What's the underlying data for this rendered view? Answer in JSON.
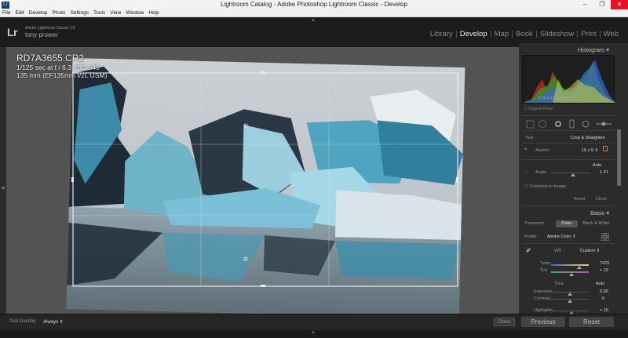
{
  "window": {
    "title": "Lightroom Catalog - Adobe Photoshop Lightroom Classic - Develop",
    "min": "–",
    "max": "❐",
    "close": "✕"
  },
  "menu": [
    "File",
    "Edit",
    "Develop",
    "Photo",
    "Settings",
    "Tools",
    "View",
    "Window",
    "Help"
  ],
  "identity": {
    "logo": "Lr",
    "product": "Adobe Lightroom Classic CC",
    "user": "tony prower"
  },
  "modules": {
    "items": [
      "Library",
      "Develop",
      "Map",
      "Book",
      "Slideshow",
      "Print",
      "Web"
    ],
    "active": "Develop"
  },
  "photo_info": {
    "filename": "RD7A3655.CR2",
    "exposure": "1/125 sec at f / 6.3, ISO 640",
    "lens": "135 mm (EF135mm f/2L USM)"
  },
  "toolbar": {
    "overlay_label": "Tool Overlay :",
    "overlay_value": "Always",
    "done": "Done",
    "previous": "Previous",
    "reset": "Reset"
  },
  "histogram": {
    "header": "Histogram",
    "stats": "R  29.1  G  31.6  B  36.7  %",
    "original_photo": "Original Photo"
  },
  "crop": {
    "tool_label": "Tool :",
    "tool_value": "Crop & Straighten",
    "aspect_label": "Aspect :",
    "aspect_value": "16 x 9",
    "auto": "Auto",
    "angle_label": "Angle",
    "angle_value": "1.41",
    "angle_fraction": 0.55,
    "constrain": "Constrain to Image",
    "reset": "Reset",
    "close": "Close"
  },
  "basic": {
    "header": "Basic",
    "treatment_label": "Treatment :",
    "treatment_color": "Color",
    "treatment_bw": "Black & White",
    "profile_label": "Profile :",
    "profile_value": "Adobe Color",
    "wb_label": "WB :",
    "wb_value": "Custom",
    "temp_label": "Temp",
    "temp_value": "7476",
    "temp_fraction": 0.75,
    "tint_label": "Tint",
    "tint_value": "+ 19",
    "tint_fraction": 0.55,
    "tone_label": "Tone",
    "tone_auto": "Auto",
    "exposure_label": "Exposure",
    "exposure_value": "0.00",
    "exposure_fraction": 0.5,
    "contrast_label": "Contrast",
    "contrast_value": "0",
    "contrast_fraction": 0.5,
    "highlights_label": "Highlights",
    "highlights_value": "+ 10",
    "highlights_fraction": 0.55
  }
}
